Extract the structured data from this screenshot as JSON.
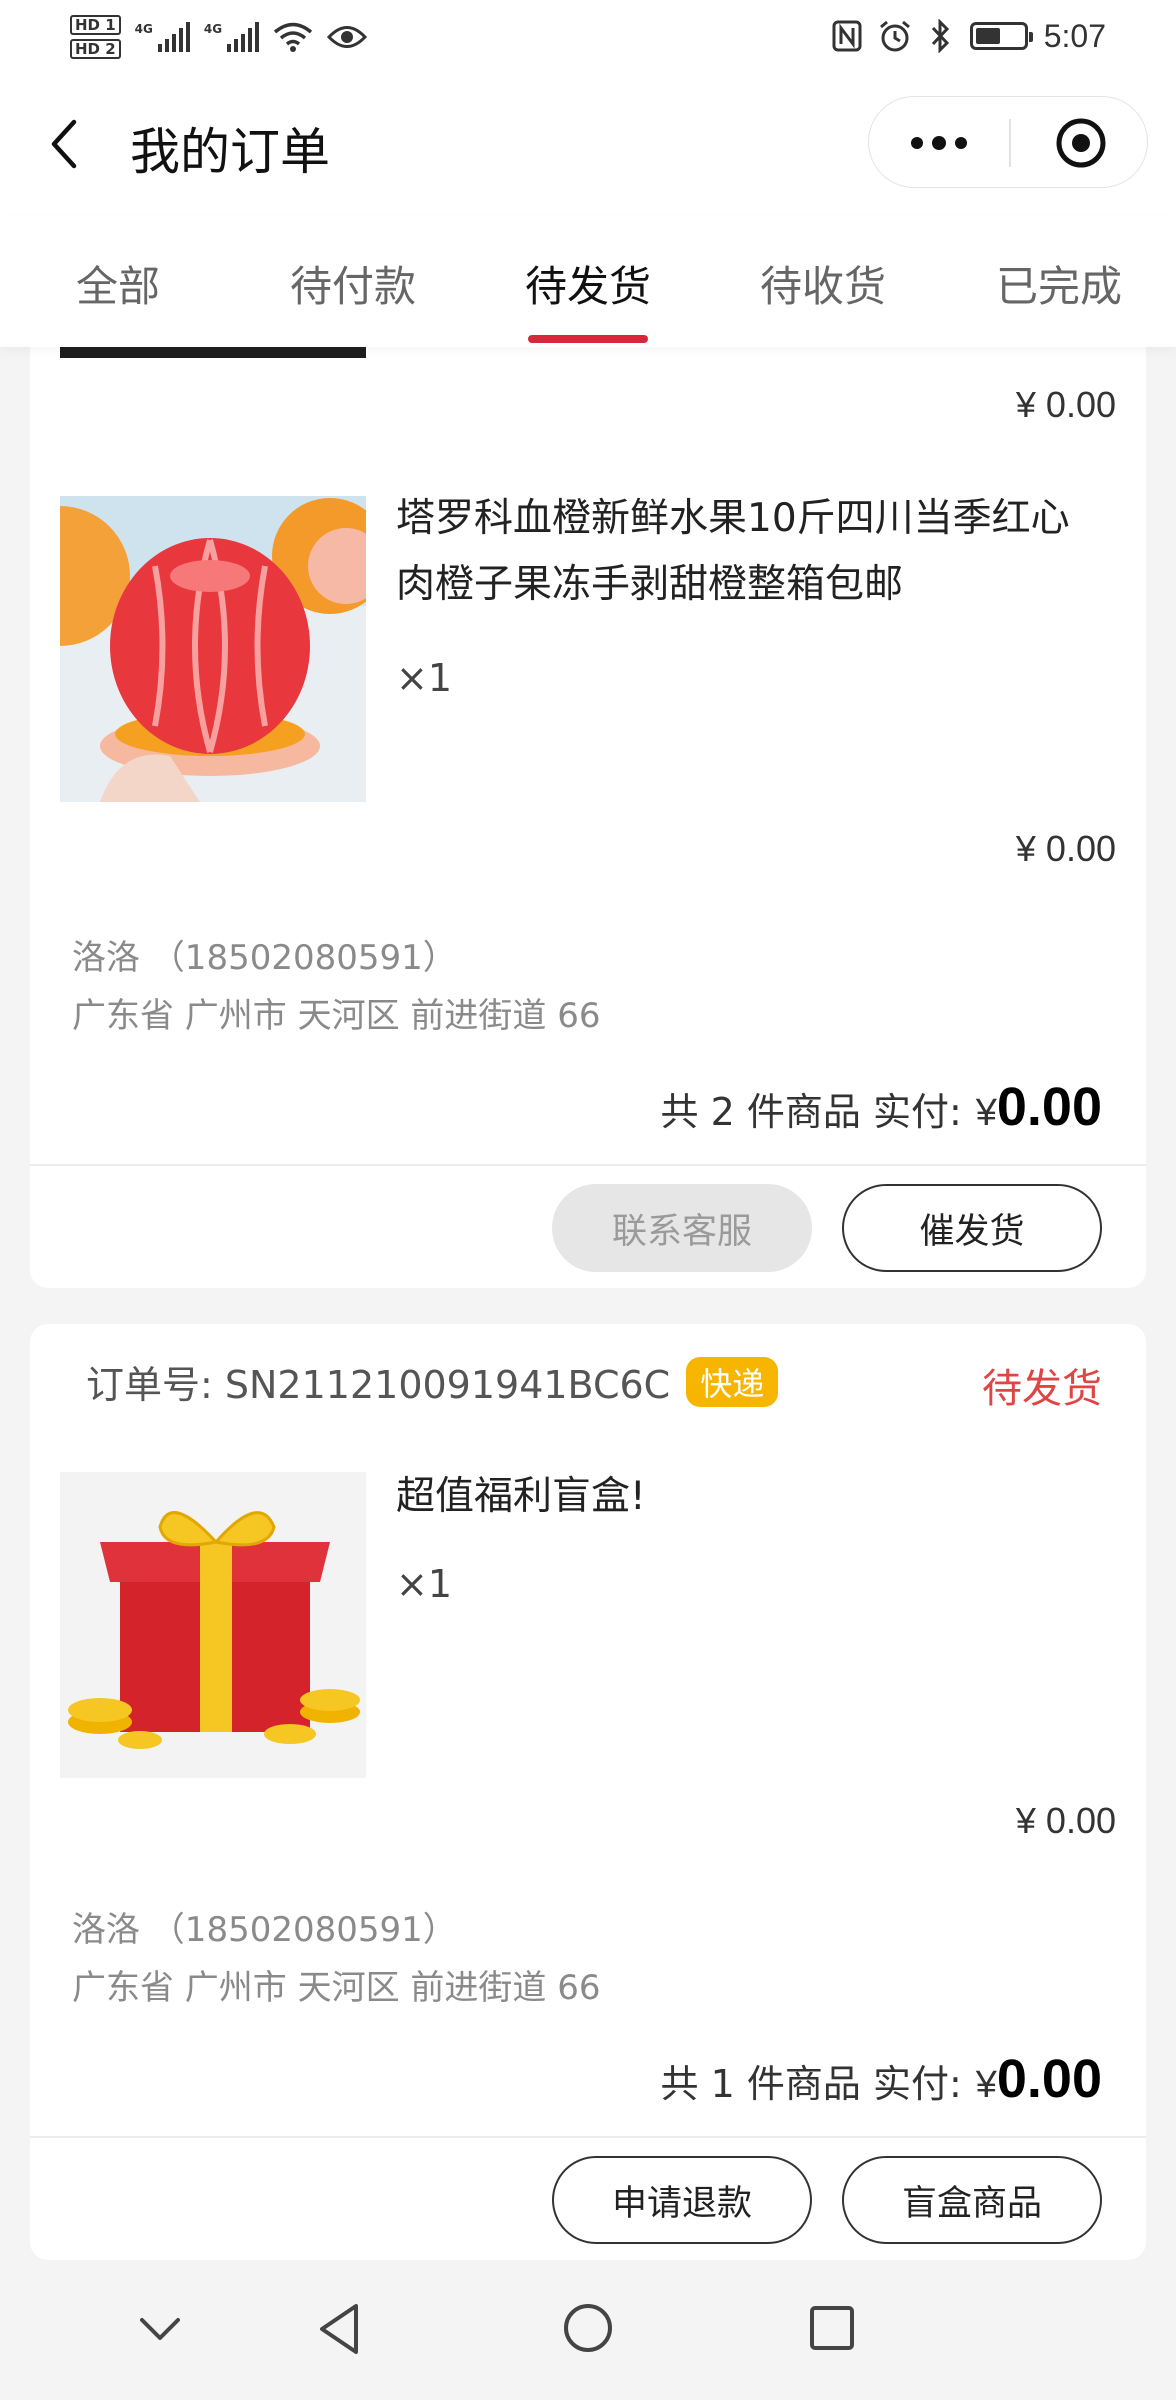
{
  "status_bar": {
    "hd1": "HD 1",
    "hd2": "HD 2",
    "net1": "4G",
    "net2": "4G",
    "time": "5:07"
  },
  "nav": {
    "title": "我的订单"
  },
  "tabs": [
    {
      "label": "全部"
    },
    {
      "label": "待付款"
    },
    {
      "label": "待发货",
      "active": true
    },
    {
      "label": "待收货"
    },
    {
      "label": "已完成"
    }
  ],
  "orders": [
    {
      "prev_item_price": "¥ 0.00",
      "item": {
        "name": "塔罗科血橙新鲜水果10斤四川当季红心肉橙子果冻手剥甜橙整箱包邮",
        "qty": "×1",
        "price": "¥ 0.00"
      },
      "recipient": "洛洛 （18502080591）",
      "address": "广东省 广州市 天河区 前进街道 66",
      "total_prefix": "共 2 件商品 实付:",
      "total_yen": "¥",
      "total_amount": "0.00",
      "buttons": [
        "联系客服",
        "催发货"
      ]
    },
    {
      "order_no": "订单号: SN211210091941BC6C",
      "tag": "快递",
      "status": "待发货",
      "item": {
        "name": "超值福利盲盒!",
        "qty": "×1",
        "price": "¥ 0.00"
      },
      "recipient": "洛洛 （18502080591）",
      "address": "广东省 广州市 天河区 前进街道 66",
      "total_prefix": "共 1 件商品 实付:",
      "total_yen": "¥",
      "total_amount": "0.00",
      "buttons": [
        "申请退款",
        "盲盒商品"
      ]
    }
  ],
  "colors": {
    "accent": "#d6283a",
    "status": "#e04545",
    "tag": "#f7b500"
  }
}
